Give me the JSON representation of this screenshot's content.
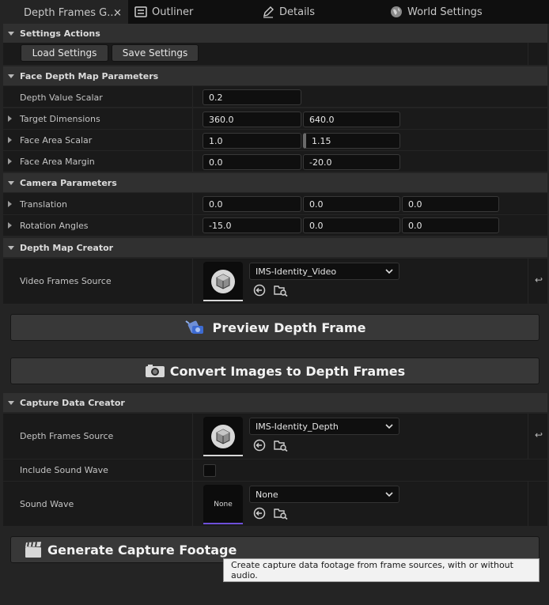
{
  "tabs": [
    {
      "label": "Depth Frames G...",
      "icon": "none",
      "active": true
    },
    {
      "label": "Outliner",
      "icon": "outliner-icon"
    },
    {
      "label": "Details",
      "icon": "pencil-icon"
    },
    {
      "label": "World Settings",
      "icon": "globe-icon"
    }
  ],
  "tab_close": "×",
  "sections": {
    "settings_actions": {
      "title": "Settings Actions",
      "load_label": "Load Settings",
      "save_label": "Save Settings"
    },
    "face_depth": {
      "title": "Face Depth Map Parameters",
      "depth_value_scalar": {
        "label": "Depth Value Scalar",
        "value": "0.2"
      },
      "target_dimensions": {
        "label": "Target Dimensions",
        "x": "360.0",
        "y": "640.0"
      },
      "face_area_scalar": {
        "label": "Face Area Scalar",
        "x": "1.0",
        "y": "1.15"
      },
      "face_area_margin": {
        "label": "Face Area Margin",
        "x": "0.0",
        "y": "-20.0"
      }
    },
    "camera": {
      "title": "Camera Parameters",
      "translation": {
        "label": "Translation",
        "x": "0.0",
        "y": "0.0",
        "z": "0.0"
      },
      "rotation": {
        "label": "Rotation Angles",
        "x": "-15.0",
        "y": "0.0",
        "z": "0.0"
      }
    },
    "depth_map_creator": {
      "title": "Depth Map Creator",
      "video_frames_source": {
        "label": "Video Frames Source",
        "asset": "IMS-Identity_Video"
      },
      "preview_label": "Preview Depth Frame",
      "convert_label": "Convert Images to Depth Frames"
    },
    "capture_data_creator": {
      "title": "Capture Data Creator",
      "depth_frames_source": {
        "label": "Depth Frames Source",
        "asset": "IMS-Identity_Depth"
      },
      "include_sound_wave": {
        "label": "Include Sound Wave",
        "checked": false
      },
      "sound_wave": {
        "label": "Sound Wave",
        "thumb": "None",
        "asset": "None"
      },
      "generate_label": "Generate Capture Footage"
    }
  },
  "tooltip": "Create capture data footage from frame sources, with or without audio.",
  "reset_glyph": "↩"
}
